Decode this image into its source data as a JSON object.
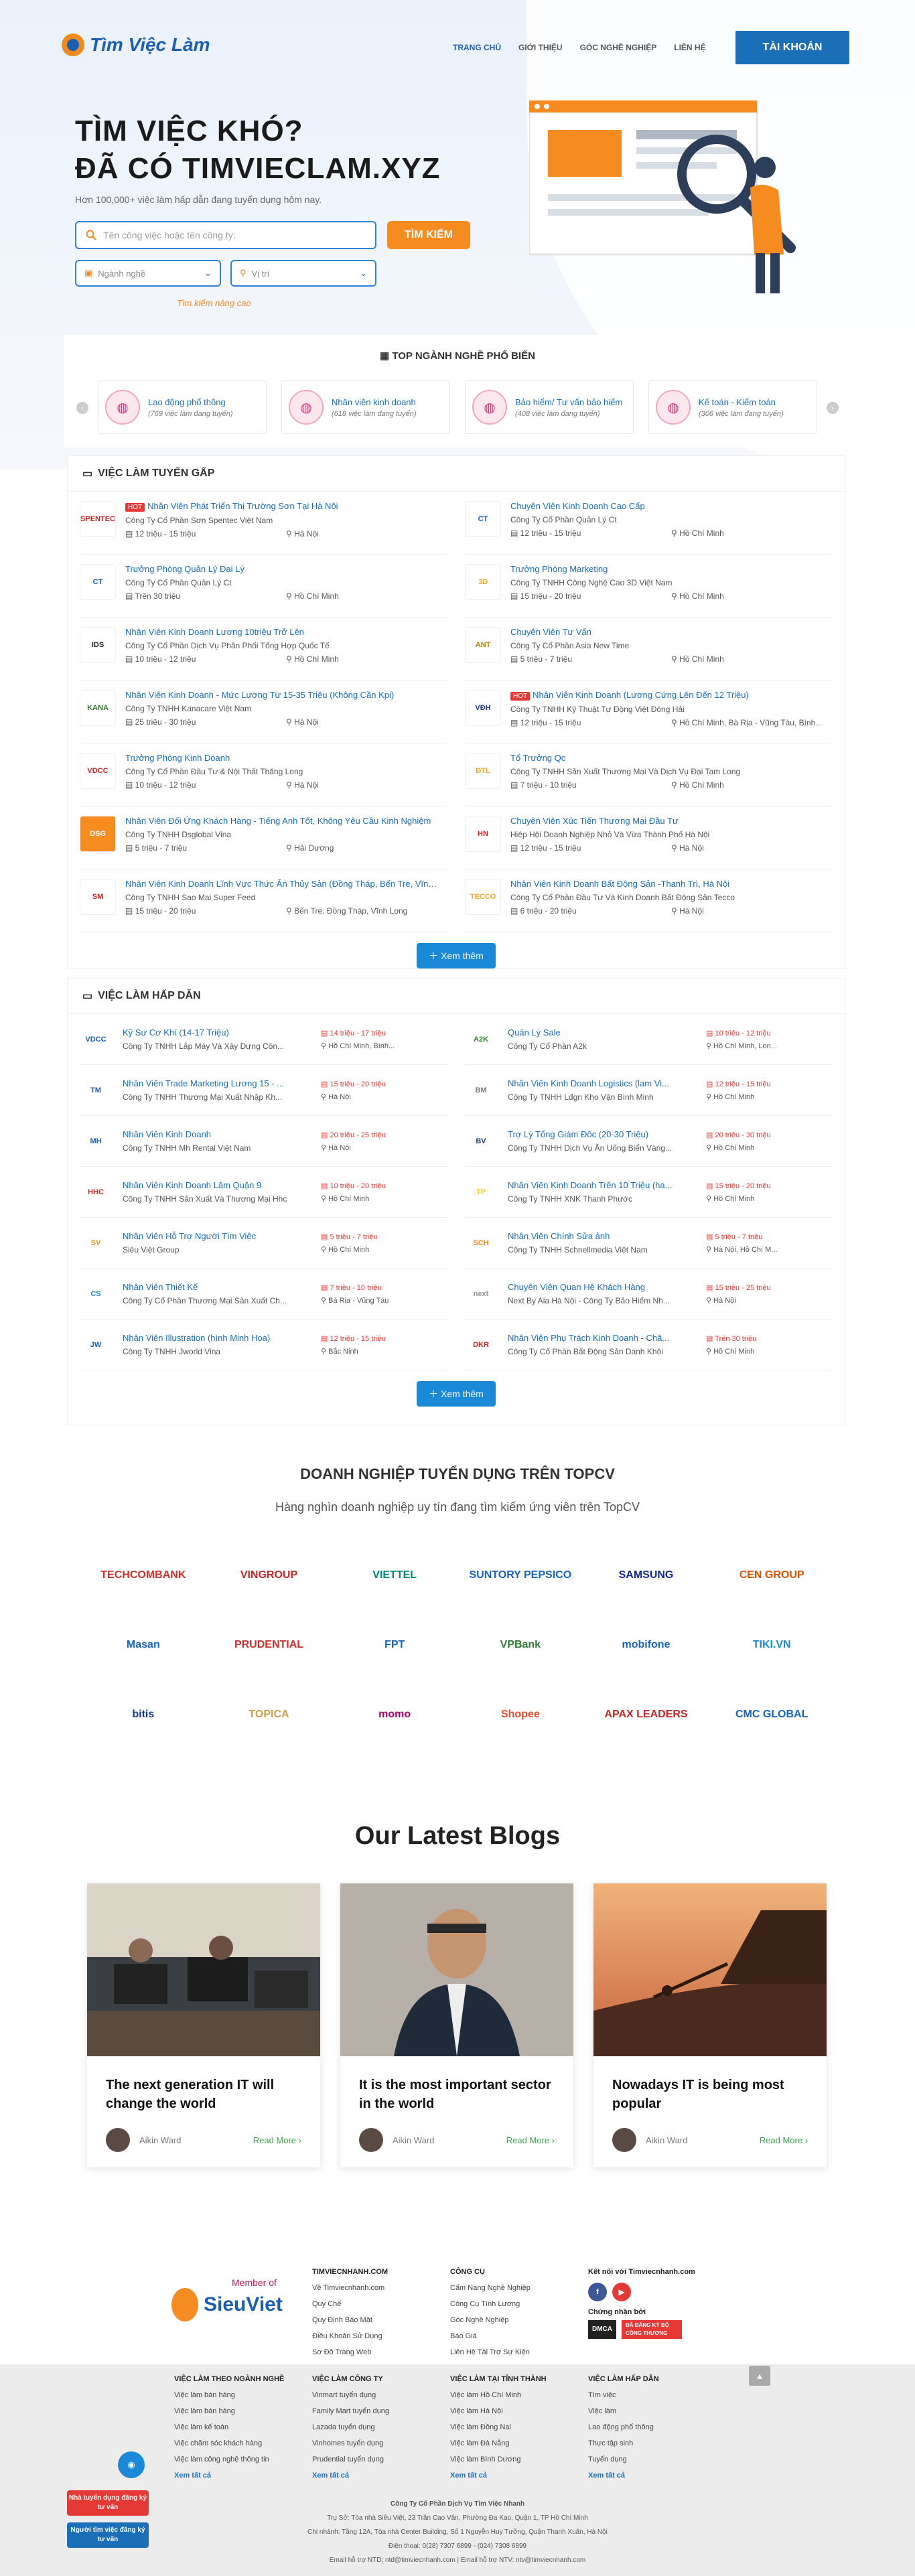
{
  "header": {
    "logo": "Tìm Việc Làm",
    "nav": [
      "TRANG CHỦ",
      "GIỚI THIỆU",
      "GÓC NGHỀ NGHIỆP",
      "LIÊN HỆ"
    ],
    "account": "TÀI KHOẢN"
  },
  "hero": {
    "line1": "TÌM VIỆC KHÓ?",
    "line2": "ĐÃ CÓ TIMVIECLAM.XYZ",
    "sub": "Hơn 100,000+ việc làm hấp dẫn đang tuyển dụng hôm nay.",
    "search_placeholder": "Tên công việc hoặc tên công ty:",
    "search_btn": "TÌM KIẾM",
    "select_career": "Ngành nghề",
    "select_location": "Vị trí",
    "advanced": "Tìm kiếm nâng cao"
  },
  "top_categories": {
    "title": "TOP NGÀNH NGHỀ PHỔ BIẾN",
    "items": [
      {
        "name": "Lao động phổ thông",
        "count": "(769 việc làm đang tuyển)"
      },
      {
        "name": "Nhân viên kinh doanh",
        "count": "(618 việc làm đang tuyển)"
      },
      {
        "name": "Bảo hiểm/ Tư vấn bảo hiểm",
        "count": "(408 việc làm đang tuyển)"
      },
      {
        "name": "Kế toán - Kiểm toán",
        "count": "(306 việc làm đang tuyển)"
      }
    ]
  },
  "urgent": {
    "title": "VIỆC LÀM TUYỂN GẤP",
    "more": "Xem thêm",
    "jobs": [
      {
        "hot": "HOT",
        "title": "Nhân Viên Phát Triển Thị Trường Sơn Tại Hà Nội",
        "company": "Công Ty Cổ Phần Sơn Spentec Việt Nam",
        "salary": "12 triệu - 15 triệu",
        "loc": "Hà Nội",
        "logo": "SPENTEC",
        "bg": "#fff",
        "fg": "#c62828"
      },
      {
        "hot": "",
        "title": "Chuyên Viên Kinh Doanh Cao Cấp",
        "company": "Công Ty Cổ Phần Quản Lý Ct",
        "salary": "12 triệu - 15 triệu",
        "loc": "Hồ Chí Minh",
        "logo": "CT",
        "bg": "#fff",
        "fg": "#1a5fb4"
      },
      {
        "hot": "",
        "title": "Trưởng Phòng Quản Lý Đại Lý",
        "company": "Công Ty Cổ Phần Quản Lý Ct",
        "salary": "Trên 30 triệu",
        "loc": "Hồ Chí Minh",
        "logo": "CT",
        "bg": "#fff",
        "fg": "#1a5fb4"
      },
      {
        "hot": "",
        "title": "Trưởng Phòng Marketing",
        "company": "Công Ty TNHH Công Nghệ Cao 3D Việt Nam",
        "salary": "15 triệu - 20 triệu",
        "loc": "Hồ Chí Minh",
        "logo": "3D",
        "bg": "#fff",
        "fg": "#f5a623"
      },
      {
        "hot": "",
        "title": "Nhân Viên Kinh Doanh Lương 10triệu Trở Lên",
        "company": "Công Ty Cổ Phần Dịch Vụ Phân Phối Tổng Hợp Quốc Tế",
        "salary": "10 triệu - 12 triệu",
        "loc": "Hồ Chí Minh",
        "logo": "IDS",
        "bg": "#fff",
        "fg": "#222"
      },
      {
        "hot": "",
        "title": "Chuyên Viên Tư Vấn",
        "company": "Công Ty Cổ Phần Asia New Time",
        "salary": "5 triệu - 7 triệu",
        "loc": "Hồ Chí Minh",
        "logo": "ANT",
        "bg": "#fff",
        "fg": "#b8860b"
      },
      {
        "hot": "",
        "title": "Nhân Viên Kinh Doanh - Mức Lương Từ 15-35 Triệu (Không Cần Kpi)",
        "company": "Công Ty TNHH Kanacare Việt Nam",
        "salary": "25 triệu - 30 triệu",
        "loc": "Hà Nội",
        "logo": "KANA",
        "bg": "#fff",
        "fg": "#2e7d32"
      },
      {
        "hot": "HOT",
        "title": "Nhân Viên Kinh Doanh (Lương Cứng Lên Đến 12 Triệu)",
        "company": "Công Ty TNHH Kỹ Thuật Tự Động Việt Đông Hải",
        "salary": "12 triệu - 15 triệu",
        "loc": "Hồ Chí Minh, Bà Rịa - Vũng Tàu, Bình...",
        "logo": "VĐH",
        "bg": "#fff",
        "fg": "#1a3a8a"
      },
      {
        "hot": "",
        "title": "Trưởng Phòng Kinh Doanh",
        "company": "Công Ty Cổ Phần Đầu Tư & Nội Thất Thăng Long",
        "salary": "10 triệu - 12 triệu",
        "loc": "Hà Nội",
        "logo": "VDCC",
        "bg": "#fff",
        "fg": "#c62828"
      },
      {
        "hot": "",
        "title": "Tổ Trưởng Qc",
        "company": "Công Ty TNHH Sản Xuất Thương Mại Và Dịch Vụ Đại Tam Long",
        "salary": "7 triệu - 10 triệu",
        "loc": "Hồ Chí Minh",
        "logo": "ĐTL",
        "bg": "#fff",
        "fg": "#f5a623"
      },
      {
        "hot": "",
        "title": "Nhân Viên Đối Ứng Khách Hàng - Tiếng Anh Tốt, Không Yêu Cầu Kinh Nghiệm",
        "company": "Công Ty TNHH Dsglobal Vina",
        "salary": "5 triệu - 7 triệu",
        "loc": "Hải Dương",
        "logo": "DSG",
        "bg": "#f68b1f",
        "fg": "#fff"
      },
      {
        "hot": "",
        "title": "Chuyên Viên Xúc Tiến Thương Mại Đầu Tư",
        "company": "Hiệp Hội Doanh Nghiệp Nhỏ Và Vừa Thành Phố Hà Nội",
        "salary": "12 triệu - 15 triệu",
        "loc": "Hà Nội",
        "logo": "HN",
        "bg": "#fff",
        "fg": "#c62828"
      },
      {
        "hot": "",
        "title": "Nhân Viên Kinh Doanh Lĩnh Vực Thức Ăn Thủy Sản (Đồng Tháp, Bến Tre, Vĩnh...",
        "company": "Công Ty TNHH Sao Mai Super Feed",
        "salary": "15 triệu - 20 triệu",
        "loc": "Bến Tre, Đồng Tháp, Vĩnh Long",
        "logo": "SM",
        "bg": "#fff",
        "fg": "#c62828"
      },
      {
        "hot": "",
        "title": "Nhân Viên Kinh Doanh Bất Động Sản -Thanh Trì, Hà Nội",
        "company": "Công Ty Cổ Phần Đầu Tư Và Kinh Doanh Bất Động Sản Tecco",
        "salary": "6 triệu - 20 triệu",
        "loc": "Hà Nội",
        "logo": "TECCO",
        "bg": "#fff",
        "fg": "#f5a623"
      }
    ]
  },
  "attractive": {
    "title": "VIỆC LÀM HẤP DẪN",
    "more": "Xem thêm",
    "jobs": [
      {
        "title": "Kỹ Sư Cơ Khí (14-17 Triệu)",
        "company": "Công Ty TNHH Lắp Máy Và Xây Dựng Côn...",
        "salary": "14 triệu - 17 triệu",
        "loc": "Hồ Chí Minh, Bình...",
        "logo": "VDCC",
        "fg": "#1a5fb4"
      },
      {
        "title": "Quản Lý Sale",
        "company": "Công Ty Cổ Phần A2k",
        "salary": "10 triệu - 12 triệu",
        "loc": "Hồ Chí Minh, Lon...",
        "logo": "A2K",
        "fg": "#2e7d32"
      },
      {
        "title": "Nhân Viên Trade Marketing Lương 15 - ...",
        "company": "Công Ty TNHH Thương Mại Xuất Nhập Kh...",
        "salary": "15 triệu - 20 triệu",
        "loc": "Hà Nội",
        "logo": "TM",
        "fg": "#1a5fb4"
      },
      {
        "title": "Nhân Viên Kinh Doanh Logistics (lam Vi...",
        "company": "Công Ty TNHH Lđgn Kho Vận Bình Minh",
        "salary": "12 triệu - 15 triệu",
        "loc": "Hồ Chí Minh",
        "logo": "BM",
        "fg": "#777"
      },
      {
        "title": "Nhân Viên Kinh Doanh",
        "company": "Công Ty TNHH Mh Rental Việt Nam",
        "salary": "20 triệu - 25 triệu",
        "loc": "Hà Nội",
        "logo": "MH",
        "fg": "#1a5fb4"
      },
      {
        "title": "Trợ Lý Tổng Giám Đốc (20-30 Triệu)",
        "company": "Công Ty TNHH Dịch Vụ Ăn Uống Biển Vàng...",
        "salary": "20 triệu - 30 triệu",
        "loc": "Hồ Chí Minh",
        "logo": "BV",
        "fg": "#1a3a8a"
      },
      {
        "title": "Nhân Viên Kinh Doanh Lâm Quận 9",
        "company": "Công Ty TNHH Sản Xuất Và Thương Mại Hhc",
        "salary": "10 triệu - 20 triệu",
        "loc": "Hồ Chí Minh",
        "logo": "HHC",
        "fg": "#c62828"
      },
      {
        "title": "Nhân Viên Kinh Doanh Trên 10 Triệu (ha...",
        "company": "Công Ty TNHH XNK Thanh Phước",
        "salary": "15 triệu - 20 triệu",
        "loc": "Hồ Chí Minh",
        "logo": "TP",
        "fg": "#f5d300"
      },
      {
        "title": "Nhân Viên Hỗ Trợ Người Tìm Việc",
        "company": "Siêu Việt Group",
        "salary": "5 triệu - 7 triệu",
        "loc": "Hồ Chí Minh",
        "logo": "SV",
        "fg": "#f68b1f"
      },
      {
        "title": "Nhân Viên Chính Sửa ảnh",
        "company": "Công Ty TNHH Schnellmedia Việt Nam",
        "salary": "5 triệu - 7 triệu",
        "loc": "Hà Nội, Hồ Chí M...",
        "logo": "SCH",
        "fg": "#f68b1f"
      },
      {
        "title": "Nhân Viên Thiết Kế",
        "company": "Công Ty Cổ Phần Thương Mại Sản Xuất Ch...",
        "salary": "7 triệu - 10 triệu",
        "loc": "Bà Rịa - Vũng Tàu",
        "logo": "CS",
        "fg": "#1a8ad8"
      },
      {
        "title": "Chuyên Viên Quan Hệ Khách Hàng",
        "company": "Next By Aia Hà Nội - Công Ty Bảo Hiểm Nh...",
        "salary": "15 triệu - 25 triệu",
        "loc": "Hà Nội",
        "logo": "next",
        "fg": "#999"
      },
      {
        "title": "Nhân Viên Illustration (hình Minh Họa)",
        "company": "Công Ty TNHH Jworld Vina",
        "salary": "12 triệu - 15 triệu",
        "loc": "Bắc Ninh",
        "logo": "JW",
        "fg": "#1a5fb4"
      },
      {
        "title": "Nhân Viên Phụ Trách Kinh Doanh - Chă...",
        "company": "Công Ty Cổ Phần Bất Động Sản Danh Khôi",
        "salary": "Trên 30 triệu",
        "loc": "Hồ Chí Minh",
        "logo": "DKR",
        "fg": "#c62828"
      }
    ]
  },
  "companies": {
    "title": "DOANH NGHIỆP TUYỂN DỤNG TRÊN TOPCV",
    "sub": "Hàng nghìn doanh nghiệp uy tín đang tìm kiếm ứng viên trên TopCV",
    "items": [
      {
        "name": "TECHCOMBANK",
        "color": "#d32f2f"
      },
      {
        "name": "VINGROUP",
        "color": "#c62828"
      },
      {
        "name": "VIETTEL",
        "color": "#00897b"
      },
      {
        "name": "SUNTORY PEPSICO",
        "color": "#1565c0"
      },
      {
        "name": "SAMSUNG",
        "color": "#1428a0"
      },
      {
        "name": "CEN GROUP",
        "color": "#e65100"
      },
      {
        "name": "Masan",
        "color": "#1565c0"
      },
      {
        "name": "PRUDENTIAL",
        "color": "#d32f2f"
      },
      {
        "name": "FPT",
        "color": "#1565c0"
      },
      {
        "name": "VPBank",
        "color": "#2e7d32"
      },
      {
        "name": "mobifone",
        "color": "#1565c0"
      },
      {
        "name": "TIKI.VN",
        "color": "#1a8ad8"
      },
      {
        "name": "bitis",
        "color": "#1a3a8a"
      },
      {
        "name": "TOPICA",
        "color": "#c8a24a"
      },
      {
        "name": "momo",
        "color": "#a50064"
      },
      {
        "name": "Shopee",
        "color": "#ee4d2d"
      },
      {
        "name": "APAX LEADERS",
        "color": "#c62828"
      },
      {
        "name": "CMC GLOBAL",
        "color": "#1565c0"
      }
    ]
  },
  "blogs": {
    "title": "Our Latest Blogs",
    "items": [
      {
        "title": "The next generation IT will change the world",
        "author": "Aikin Ward",
        "more": "Read More ›"
      },
      {
        "title": "It is the most important sector in the world",
        "author": "Aikin Ward",
        "more": "Read More ›"
      },
      {
        "title": "Nowadays IT is being most popular",
        "author": "Aikin Ward",
        "more": "Read More ›"
      }
    ]
  },
  "footer": {
    "member": "Member of",
    "brand": "SieuViet",
    "col1": {
      "head": "TIMVIECNHANH.COM",
      "links": [
        "Về Timviecnhanh.com",
        "Quy Chế",
        "Quy Định Bảo Mật",
        "Điều Khoản Sử Dụng",
        "Sơ Đồ Trang Web"
      ]
    },
    "col2": {
      "head": "CÔNG CỤ",
      "links": [
        "Cẩm Nang Nghề Nghiệp",
        "Công Cụ Tính Lương",
        "Góc Nghề Nghiệp",
        "Báo Giá",
        "Liên Hệ Tài Trợ Sự Kiện"
      ]
    },
    "col3": {
      "head": "Kết nối với Timviecnhanh.com",
      "cert": "Chứng nhận bởi",
      "dmca": "DMCA",
      "bct": "ĐÃ ĐĂNG KÝ BỘ CÔNG THƯƠNG"
    },
    "b1": {
      "head": "VIỆC LÀM THEO NGÀNH NGHỀ",
      "links": [
        "Việc làm bán hàng",
        "Việc làm bán hàng",
        "Việc làm kế toán",
        "Việc chăm sóc khách hàng",
        "Việc làm công nghệ thông tin"
      ],
      "more": "Xem tất cả"
    },
    "b2": {
      "head": "VIỆC LÀM CÔNG TY",
      "links": [
        "Vinmart tuyển dụng",
        "Family Mart tuyển dụng",
        "Lazada tuyển dụng",
        "Vinhomes tuyển dụng",
        "Prudential tuyển dụng"
      ],
      "more": "Xem tất cả"
    },
    "b3": {
      "head": "VIỆC LÀM TẠI TỈNH THÀNH",
      "links": [
        "Việc làm Hồ Chí Minh",
        "Việc làm Hà Nội",
        "Việc làm Đồng Nai",
        "Việc làm Đà Nẵng",
        "Việc làm Bình Dương"
      ],
      "more": "Xem tất cả"
    },
    "b4": {
      "head": "VIỆC LÀM HẤP DẪN",
      "links": [
        "Tìm việc",
        "Việc làm",
        "Lao động phổ thông",
        "Thực tập sinh",
        "Tuyển dụng"
      ],
      "more": "Xem tất cả"
    },
    "addr": [
      "Công Ty Cổ Phần Dịch Vụ Tìm Việc Nhanh",
      "Trụ Sở: Tòa nhà Siêu Việt, 23 Trần Cao Vân, Phường Đa Kao, Quận 1, TP Hồ Chí Minh",
      "Chi nhánh: Tầng 12A, Tòa nhà Center Building, Số 1 Nguyễn Huy Tưởng, Quận Thanh Xuân, Hà Nội",
      "Điện thoại: 0(28) 7307 6899 - (024) 7308 6899",
      "Email hỗ trợ NTD: ntd@timviecnhanh.com | Email hỗ trợ NTV: ntv@timviecnhanh.com"
    ],
    "float1": "Nhà tuyển dụng đăng ký tư vấn",
    "float2": "Người tìm việc đăng ký tư vấn"
  },
  "colors": {
    "primary": "#1a6fb8",
    "accent": "#f68b1f",
    "hot": "#e53935"
  }
}
